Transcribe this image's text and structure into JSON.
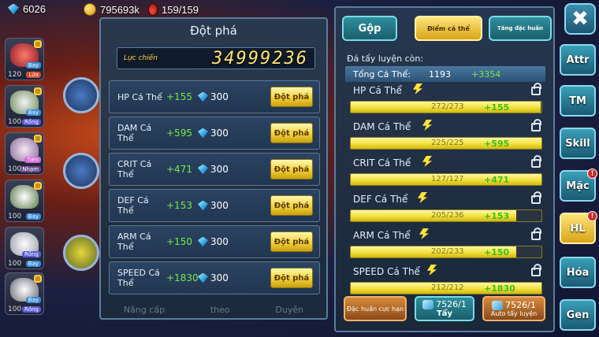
{
  "resources": {
    "gems": "6026",
    "gold": "795693k",
    "stamina": "159/159"
  },
  "team": [
    {
      "level": "120",
      "tags": [
        "Bay",
        "Lửa"
      ],
      "color": "#d84a4a"
    },
    {
      "level": "100",
      "tags": [
        "Bay",
        "Rồng"
      ],
      "color": "#e0e0e0"
    },
    {
      "level": "100",
      "tags": [
        "Tiên",
        "Nhạm"
      ],
      "color": "#d8d0e8"
    },
    {
      "level": "100",
      "tags": [
        "Bay"
      ],
      "color": "#d8e0d0"
    },
    {
      "level": "100",
      "tags": [
        "Rồng",
        "Bay"
      ],
      "color": "#f0f0f0"
    },
    {
      "level": "100",
      "tags": [
        "Bay",
        "Rồng"
      ],
      "color": "#e8e8e8"
    }
  ],
  "breakthrough": {
    "title": "Đột phá",
    "power_label": "Lực chiến",
    "power_value": "34999236",
    "button_label": "Đột phá",
    "rows": [
      {
        "stat": "HP Cá Thể",
        "bonus": "+155",
        "cost": "300"
      },
      {
        "stat": "DAM Cá Thể",
        "bonus": "+595",
        "cost": "300"
      },
      {
        "stat": "CRIT Cá Thể",
        "bonus": "+471",
        "cost": "300"
      },
      {
        "stat": "DEF Cá Thể",
        "bonus": "+153",
        "cost": "300"
      },
      {
        "stat": "ARM Cá Thể",
        "bonus": "+150",
        "cost": "300"
      },
      {
        "stat": "SPEED Cá Thể",
        "bonus": "+1830",
        "cost": "300"
      }
    ],
    "bottom_labels": [
      "Nâng cấp",
      "theo",
      "Duyên"
    ]
  },
  "stats_panel": {
    "tabs": {
      "merge": "Gộp",
      "stat_points": "Điểm cá thể",
      "special": "Tăng đặc huấn"
    },
    "remaining_label": "Đá tẩy luyện còn:",
    "total_label": "Tổng Cá Thể:",
    "total_value": "1193",
    "total_bonus": "+3354",
    "stats": [
      {
        "name": "HP Cá Thể",
        "progress": "272/273",
        "fraction": 0.996,
        "bonus": "+155"
      },
      {
        "name": "DAM Cá Thể",
        "progress": "225/225",
        "fraction": 1.0,
        "bonus": "+595"
      },
      {
        "name": "CRIT Cá Thể",
        "progress": "127/127",
        "fraction": 1.0,
        "bonus": "+471"
      },
      {
        "name": "DEF Cá Thể",
        "progress": "205/236",
        "fraction": 0.869,
        "bonus": "+153"
      },
      {
        "name": "ARM Cá Thể",
        "progress": "202/233",
        "fraction": 0.867,
        "bonus": "+150"
      },
      {
        "name": "SPEED Cá Thể",
        "progress": "212/212",
        "fraction": 1.0,
        "bonus": "+1830"
      }
    ],
    "buttons": {
      "special_training": "Đặc huấn cực hạn",
      "wash_count": "7526/1",
      "wash_label": "Tẩy",
      "auto_count": "7526/1",
      "auto_label": "Auto tẩy luyện"
    }
  },
  "nav": {
    "close": "✖",
    "items": [
      {
        "label": "Attr",
        "badge": ""
      },
      {
        "label": "TM",
        "badge": ""
      },
      {
        "label": "Skill",
        "badge": ""
      },
      {
        "label": "Mặc",
        "badge": "!"
      },
      {
        "label": "HL",
        "badge": "!",
        "active": true
      },
      {
        "label": "Hóa",
        "badge": ""
      },
      {
        "label": "Gen",
        "badge": ""
      }
    ]
  }
}
